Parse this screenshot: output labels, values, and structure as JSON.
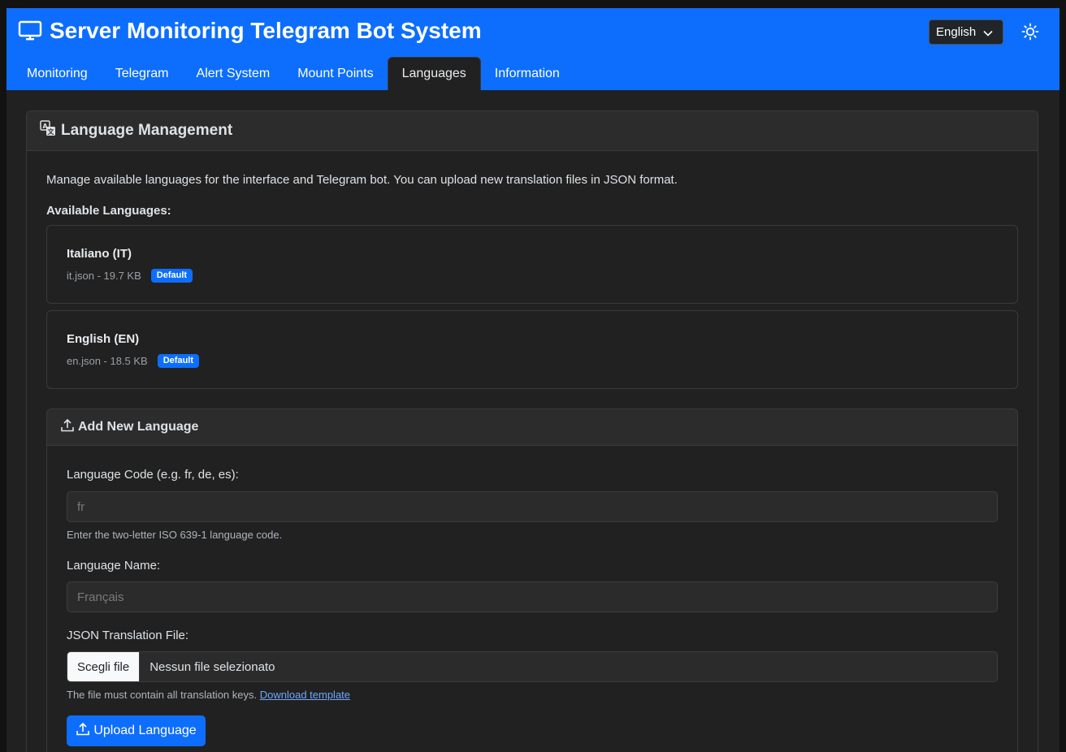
{
  "app": {
    "title": "Server Monitoring Telegram Bot System",
    "icon": "monitor-icon",
    "language_selector": "English",
    "theme_icon": "sun-icon"
  },
  "tabs": [
    {
      "label": "Monitoring",
      "active": false
    },
    {
      "label": "Telegram",
      "active": false
    },
    {
      "label": "Alert System",
      "active": false
    },
    {
      "label": "Mount Points",
      "active": false
    },
    {
      "label": "Languages",
      "active": true
    },
    {
      "label": "Information",
      "active": false
    }
  ],
  "card": {
    "title": "Language Management",
    "icon": "translate-icon",
    "description": "Manage available languages for the interface and Telegram bot. You can upload new translation files in JSON format.",
    "available_label": "Available Languages:"
  },
  "languages": [
    {
      "name": "Italiano (IT)",
      "meta": "it.json - 19.7 KB",
      "badge": "Default"
    },
    {
      "name": "English (EN)",
      "meta": "en.json - 18.5 KB",
      "badge": "Default"
    }
  ],
  "add_language": {
    "title": "Add New Language",
    "icon": "upload-icon",
    "code_label": "Language Code (e.g. fr, de, es):",
    "code_placeholder": "fr",
    "code_help": "Enter the two-letter ISO 639-1 language code.",
    "name_label": "Language Name:",
    "name_placeholder": "Français",
    "file_label": "JSON Translation File:",
    "file_button": "Scegli file",
    "file_status": "Nessun file selezionato",
    "file_help": "The file must contain all translation keys.",
    "template_link": "Download template",
    "upload_button": "Upload Language"
  },
  "colors": {
    "accent": "#0d6efd",
    "background": "#212121",
    "link": "#6ea8fe"
  }
}
